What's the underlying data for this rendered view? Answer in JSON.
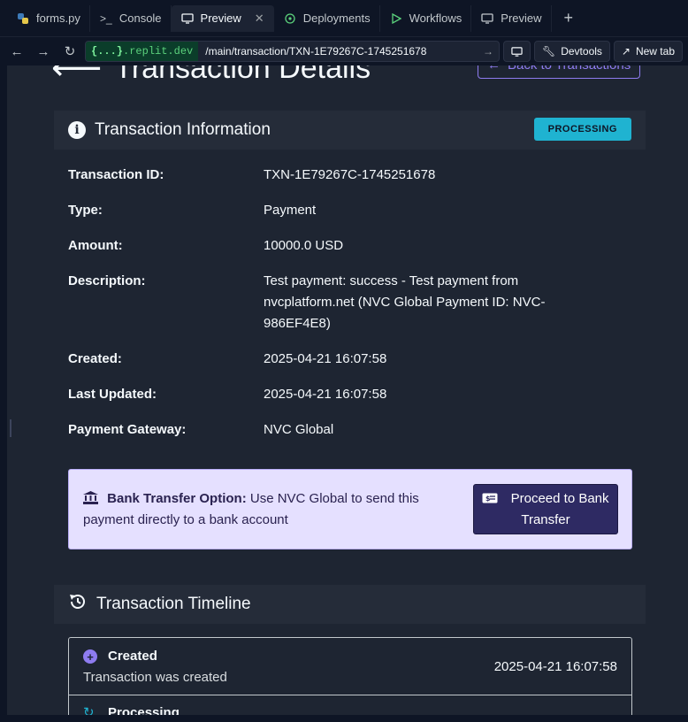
{
  "tabs": [
    {
      "label": "forms.py",
      "icon": "python-icon"
    },
    {
      "label": "Console",
      "icon": "console-icon"
    },
    {
      "label": "Preview",
      "icon": "monitor-icon",
      "active": true
    },
    {
      "label": "Deployments",
      "icon": "deployments-icon"
    },
    {
      "label": "Workflows",
      "icon": "play-icon"
    },
    {
      "label": "Preview",
      "icon": "monitor-icon"
    }
  ],
  "url": {
    "domain_prefix": "{...}",
    "domain": ".replit.dev",
    "path": "/main/transaction/TXN-1E79267C-1745251678",
    "devtools": "Devtools",
    "new_tab": "New tab"
  },
  "page": {
    "title": "Transaction Details",
    "back": "Back to Transactions"
  },
  "info": {
    "heading": "Transaction Information",
    "status": "PROCESSING",
    "rows": [
      {
        "k": "Transaction ID:",
        "v": "TXN-1E79267C-1745251678"
      },
      {
        "k": "Type:",
        "v": "Payment"
      },
      {
        "k": "Amount:",
        "v": "10000.0 USD"
      },
      {
        "k": "Description:",
        "v": "Test payment: success - Test payment from nvcplatform.net (NVC Global Payment ID: NVC-986EF4E8)"
      },
      {
        "k": "Created:",
        "v": "2025-04-21 16:07:58"
      },
      {
        "k": "Last Updated:",
        "v": "2025-04-21 16:07:58"
      },
      {
        "k": "Payment Gateway:",
        "v": "NVC Global"
      }
    ]
  },
  "bank": {
    "label": "Bank Transfer Option:",
    "text": " Use NVC Global to send this payment directly to a bank account",
    "button": "Proceed to Bank Transfer"
  },
  "timeline": {
    "heading": "Transaction Timeline",
    "items": [
      {
        "title": "Created",
        "desc": "Transaction was created",
        "date": "2025-04-21 16:07:58"
      },
      {
        "title": "Processing"
      }
    ]
  },
  "colors": {
    "accent": "#8e7cf0",
    "status": "#1fb3d1",
    "bank_bg": "#e5e0ff"
  }
}
